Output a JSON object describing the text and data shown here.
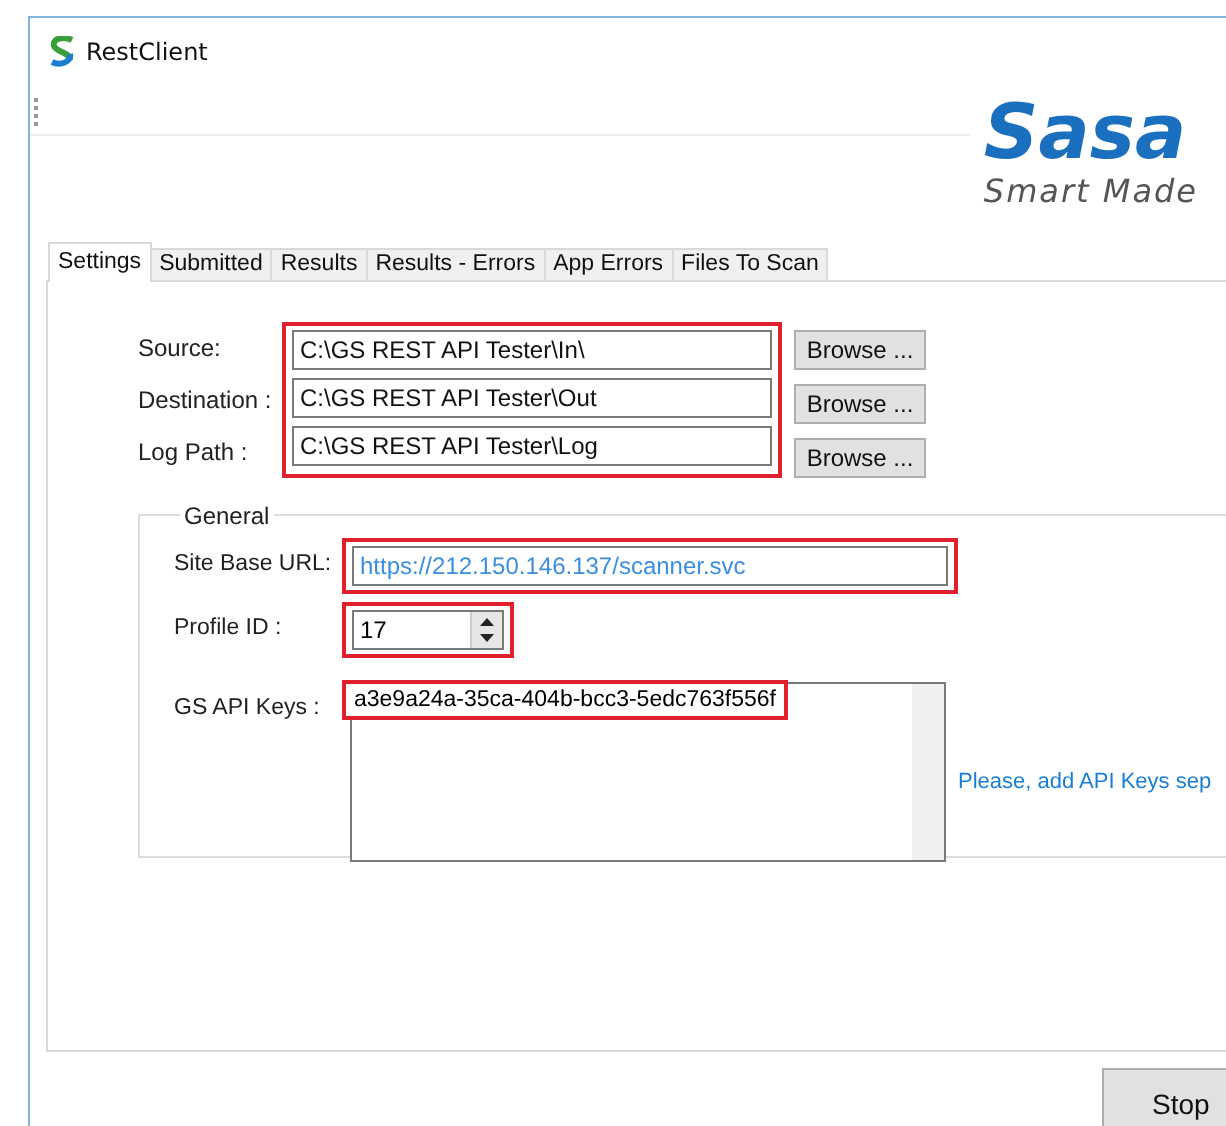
{
  "window": {
    "title": "RestClient"
  },
  "logo": {
    "brand": "Sasa",
    "tagline": "Smart Made"
  },
  "tabs": [
    {
      "label": "Settings",
      "selected": true
    },
    {
      "label": "Submitted",
      "selected": false
    },
    {
      "label": "Results",
      "selected": false
    },
    {
      "label": "Results - Errors",
      "selected": false
    },
    {
      "label": "App Errors",
      "selected": false
    },
    {
      "label": "Files To Scan",
      "selected": false
    }
  ],
  "paths": {
    "highlighted": true,
    "rows": [
      {
        "label": "Source:",
        "value": "C:\\GS REST API Tester\\In\\",
        "button": "Browse ..."
      },
      {
        "label": "Destination :",
        "value": "C:\\GS REST API Tester\\Out",
        "button": "Browse ..."
      },
      {
        "label": "Log Path :",
        "value": "C:\\GS REST API Tester\\Log",
        "button": "Browse ..."
      }
    ]
  },
  "general": {
    "title": "General",
    "site_url": {
      "label": "Site Base URL:",
      "value": "https://212.150.146.137/scanner.svc",
      "highlighted": true
    },
    "profile_id": {
      "label": "Profile ID :",
      "value": "17",
      "highlighted": true
    },
    "api_keys": {
      "label": "GS API Keys :",
      "value": "a3e9a24a-35ca-404b-bcc3-5edc763f556f",
      "highlighted": true
    },
    "hint": "Please, add API Keys sep"
  },
  "buttons": [
    "Stop"
  ]
}
